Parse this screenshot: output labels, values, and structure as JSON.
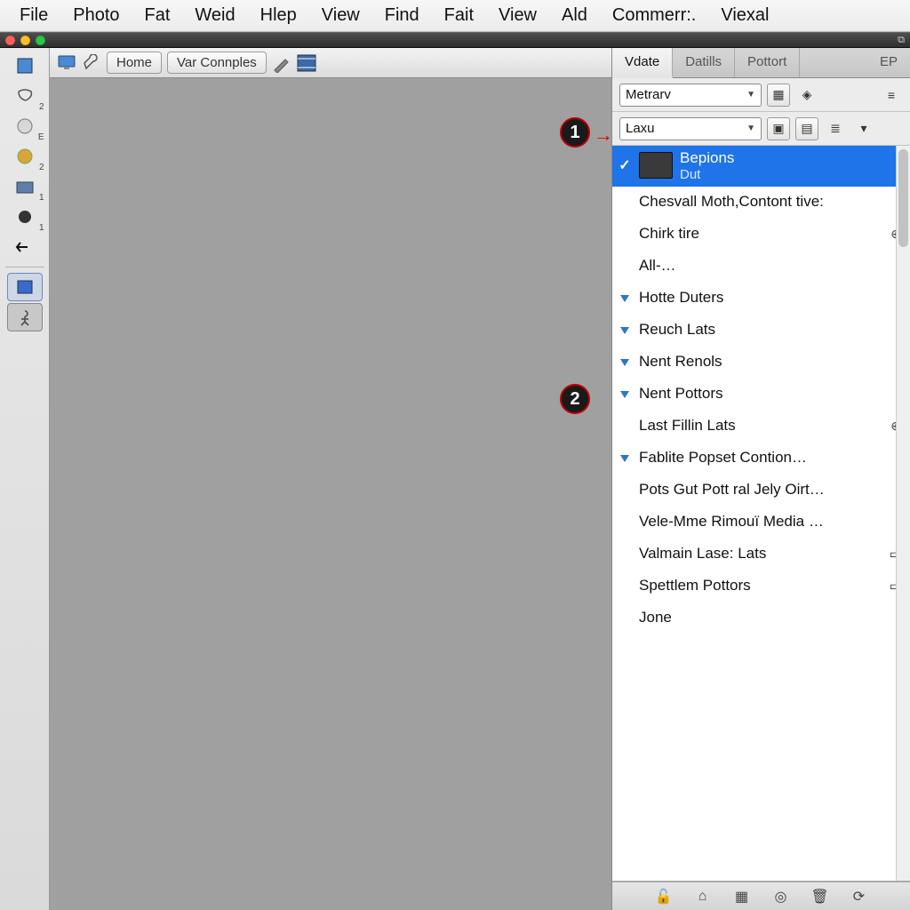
{
  "menubar": [
    "File",
    "Photo",
    "Fat",
    "Weid",
    "Hlep",
    "View",
    "Find",
    "Fait",
    "View",
    "Ald",
    "Commerr:.",
    "Viexal"
  ],
  "toolbar": {
    "home": "Home",
    "var_connples": "Var Connples"
  },
  "panel": {
    "tabs": [
      "Vdate",
      "Datills",
      "Pottort",
      "EP"
    ],
    "active_tab": 0,
    "dropdown1": "Metrarv",
    "dropdown2": "Laxu",
    "items": [
      {
        "kind": "selected",
        "title": "Bepions",
        "sub": "Dut"
      },
      {
        "kind": "plain",
        "title": "Chesvall Moth,Contont tive:"
      },
      {
        "kind": "plain",
        "title": "Chirk tire",
        "trail": "⊕"
      },
      {
        "kind": "plain",
        "title": "All-…"
      },
      {
        "kind": "tri",
        "title": "Hotte Duters"
      },
      {
        "kind": "tri",
        "title": "Reuch Lats"
      },
      {
        "kind": "tri",
        "title": "Nent Renols"
      },
      {
        "kind": "tri",
        "title": "Nent Pottors"
      },
      {
        "kind": "plain",
        "title": "Last Fillin Lats",
        "trail": "⊕"
      },
      {
        "kind": "tri",
        "title": "Fablite Popset Contion…"
      },
      {
        "kind": "plain",
        "title": "Pots Gut Pott ral Jely Oirt…"
      },
      {
        "kind": "plain",
        "title": "Vele-Mme Rimouï Media …"
      },
      {
        "kind": "plain",
        "title": "Valmain Lase: Lats",
        "trail": "▭"
      },
      {
        "kind": "plain",
        "title": "Spettlem Pottors",
        "trail": "▭"
      },
      {
        "kind": "plain",
        "title": "Jone"
      }
    ]
  },
  "annotations": {
    "b1": "1",
    "b2": "2"
  }
}
